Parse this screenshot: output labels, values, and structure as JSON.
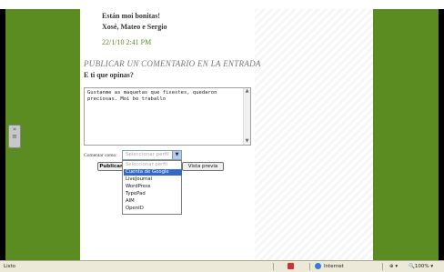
{
  "post": {
    "greeting": "Están moi bonitas!",
    "signature": "Xosé, Mateo e Sergio",
    "date": "22/1/10 2:41 PM"
  },
  "comment_form": {
    "heading": "PUBLICAR UN COMENTARIO EN LA ENTRADA",
    "question": "E ti que opinas?",
    "comment_text": "Gustanme as maquetas que fixestes, quedaron preciosas. Moi bo traballo",
    "comment_as_label": "Comentar como:",
    "profile_select_value": "Seleccionar perfil",
    "publish_button": "Publicar",
    "preview_button": "Vista previa",
    "profile_options": [
      "Seleccionar perfil",
      "Cuenta de Google",
      "LiveJournal",
      "WordPress",
      "TypePad",
      "AIM",
      "OpenID"
    ],
    "selected_option_index": 1
  },
  "status_bar": {
    "left_text": "Listo",
    "zone": "Internet",
    "zoom": "100%"
  },
  "colors": {
    "page_green": "#5b8c22",
    "date_green": "#5b8c22",
    "selection_blue": "#316ac5"
  }
}
